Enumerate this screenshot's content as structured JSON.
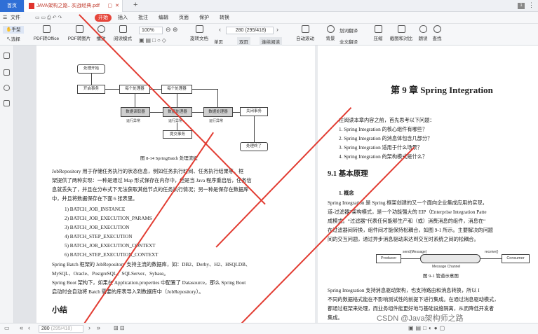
{
  "tabs": {
    "home": "首页",
    "doc": "JAVA架构之路...实战经典.pdf",
    "counter": "1"
  },
  "menu": {
    "file": "文件",
    "items": [
      "开始",
      "插入",
      "批注",
      "编辑",
      "页面",
      "保护",
      "转换"
    ]
  },
  "ribbon": {
    "hand": "手型",
    "select": "选择",
    "tools": [
      "PDF转Office",
      "PDF转图片",
      "播放",
      "阅读模式",
      "旋转文档",
      "单页",
      "双页",
      "连续阅读",
      "自动滚动",
      "背景",
      "全文翻译",
      "压缩",
      "截图和对比",
      "朗读",
      "查找"
    ],
    "zoom": "100%",
    "page": "280 (295/418)",
    "translate": "划词翻译"
  },
  "left_page": {
    "flow": {
      "start": "处理开始",
      "begin_task": "开启事务",
      "proc1": "每个处理器",
      "proc2": "每个处理器",
      "read": "数据读取器",
      "process": "数据处理器",
      "write": "数据处理器",
      "close": "关闭事务",
      "commit": "提交事务",
      "end": "处理终了",
      "run1": "运行异常",
      "run2": "运行异常",
      "run3": "运行异常"
    },
    "caption": "图 8-14 SpringBatch 处理流程",
    "para1": [
      "JobRepository 用于存储任务执行的状态信息，例如任务执行时间、任务执行结果等。框",
      "架提供了两种实现：一种是通过 Map 形式保存在内存中，但是当 Java 程序重启后，任务信",
      "息就丢失了，并且在分布式下无法获取其他节点的任务执行情况；另一种是保存在数据库",
      "中，并且将数据保存在下面 6 张表里。"
    ],
    "tables": [
      "1) BATCH_JOB_INSTANCE",
      "2) BATCH_JOB_EXECUTION_PARAMS",
      "3) BATCH_JOB_EXECUTION",
      "4) BATCH_STEP_EXECUTION",
      "5) BATCH_JOB_EXECUTION_CONTEXT",
      "6) BATCH_STEP_EXECUTION_CONTEXT"
    ],
    "para2": [
      "Spring Batch 框架的 JobRepository 支持主流的数据库，如：DB2、Derby、H2、HSQLDB、",
      "MySQL、Oracle、PostgreSQL、SQLServer、Sybase。",
      "Spring Boot 架构下，如果在 Application.properties 中配置了 Datasource，那么 Spring Boot",
      "启动时会自动将 Batch 需要的库表导入到数据库中（JobRepository）。"
    ],
    "heading": "小结"
  },
  "right_page": {
    "chapter": "第 9 章 Spring Integration",
    "intro": "在阅读本章内容之前，首先思考以下问题：",
    "questions": [
      "1. Spring Integration 的核心组件有哪些？",
      "2. Spring Integration 的消息体包含几部分？",
      "3. Spring Integration 适用于什么场景？",
      "4. Spring Integration 的架构模式是什么？"
    ],
    "section": "9.1  基本原理",
    "subsection": "1. 概念",
    "para": [
      "Spring Integration 是 Spring 框架创建的又一个面向企业集成应用的实现，",
      "道-过滤器”架构模式，是一个功能强大的 EIP（Enterprise Integration Patte",
      "成模式。“过滤器”代表任何能够生产和（或）消费消息的组件，消息在“",
      "在过滤器间转换，组件间才能保持松耦合，如图 9-1 所示。主要解决的问题",
      "间的交互问题，通过异步消息驱动来达到交互时系统之间的松耦合。"
    ],
    "diagram": {
      "producer": "Producer",
      "send": "send(Message)",
      "receive": "receive()",
      "consumer": "Consumer",
      "channel": "Message Channel"
    },
    "fig_caption": "图 9-1  管道示意图",
    "para2": [
      "Spring Integration 支持消息驱动架构，也支持路由和消息转换，所以 I",
      "不同的数据格式能在不影响测试性的前提下进行集成。在通过消息驱动模式，",
      "都通过框架来处理，而业务组件能更好地与基础设施隔离，从而降低开发者",
      "集成。"
    ]
  },
  "status": {
    "page": "280",
    "total": "(295/418)",
    "watermark": "CSDN @Java架构师之路"
  },
  "colors": {
    "accent": "#2f6fd6",
    "annotation": "#e23c32",
    "start": "#e6463b"
  }
}
